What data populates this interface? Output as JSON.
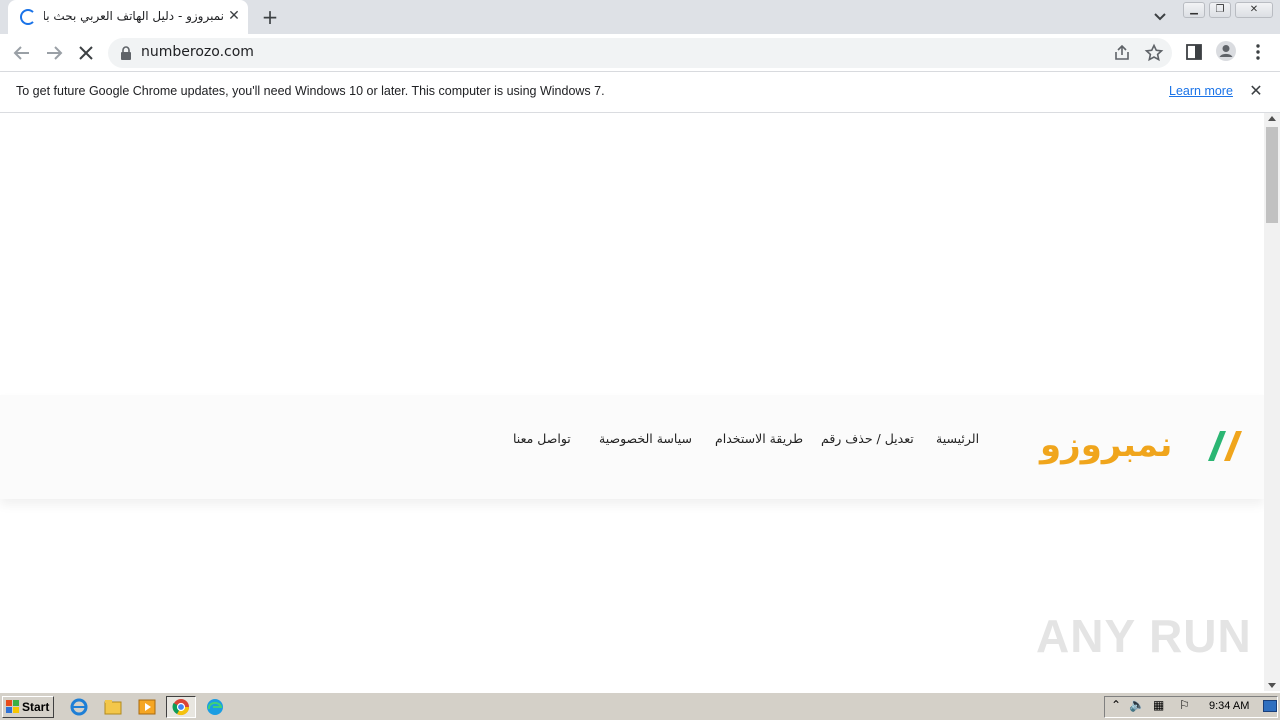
{
  "browser": {
    "tab": {
      "title": "نمبروزو - دليل الهاتف العربي بحث بالاسم",
      "close_glyph": "✕"
    },
    "new_tab_glyph": "+",
    "address": {
      "url": "numberozo.com"
    },
    "infobar": {
      "message": "To get future Google Chrome updates, you'll need Windows 10 or later. This computer is using Windows 7.",
      "link": "Learn more",
      "close_glyph": "✕"
    }
  },
  "site": {
    "logo_text": "نمبروزو",
    "nav": [
      {
        "label": "الرئيسية"
      },
      {
        "label": "تعديل / حذف رقم"
      },
      {
        "label": "طريقة الاستخدام"
      },
      {
        "label": "سياسة الخصوصية"
      },
      {
        "label": "تواصل معنا"
      }
    ]
  },
  "watermark": "ANY RUN",
  "taskbar": {
    "start_label": "Start",
    "clock": "9:34 AM"
  },
  "colors": {
    "logo_orange": "#f0a51c",
    "logo_green": "#2bb673",
    "link_blue": "#1a73e8",
    "taskbar": "#d4d0c8"
  }
}
